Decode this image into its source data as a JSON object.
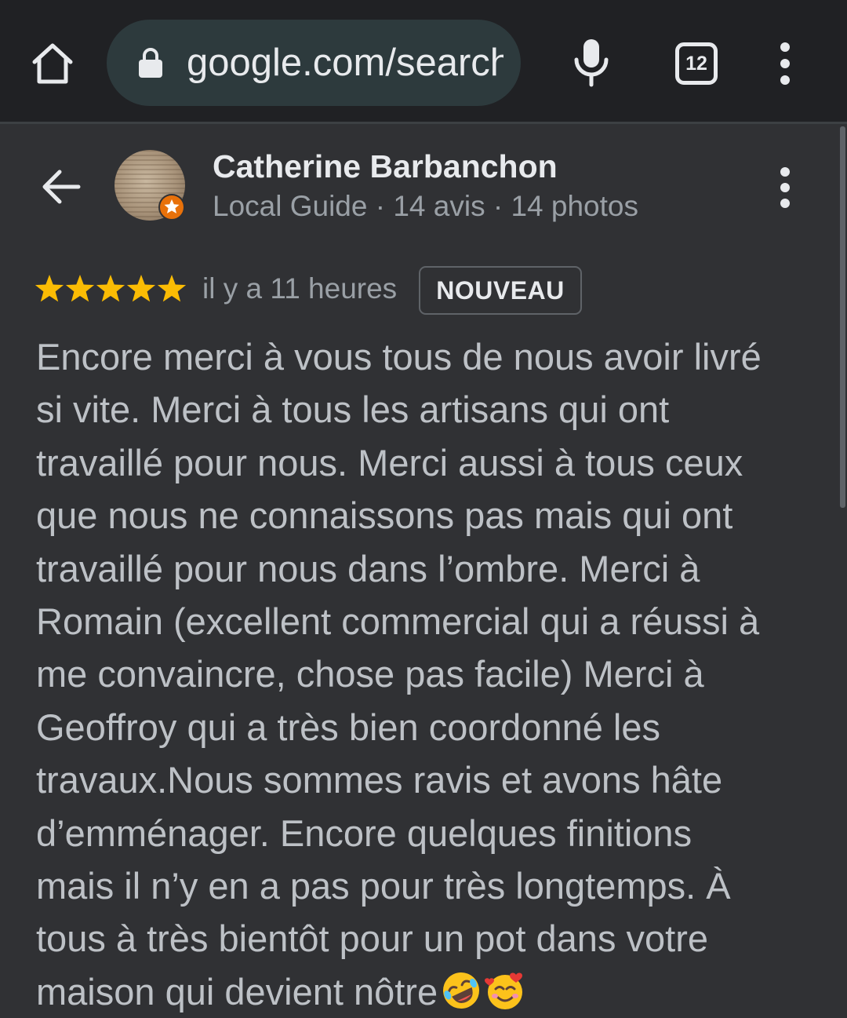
{
  "browser": {
    "url": "google.com/search",
    "tab_count": "12"
  },
  "reviewer": {
    "name": "Catherine Barbanchon",
    "meta": "Local Guide · 14 avis · 14 photos"
  },
  "review": {
    "rating": 5,
    "time": "il y a 11 heures",
    "badge": "NOUVEAU",
    "lines": [
      "Encore merci à vous tous de nous avoir livré",
      "si vite. Merci à tous les artisans qui ont",
      "travaillé pour nous. Merci aussi à tous ceux",
      "que nous ne connaissons pas mais qui ont",
      "travaillé pour nous dans l’ombre. Merci à",
      "Romain (excellent commercial qui a réussi à",
      "me convaincre, chose pas facile) Merci à",
      "Geoffroy qui a très bien coordonné les",
      "travaux.Nous sommes ravis et avons hâte",
      "d’emménager. Encore quelques finitions",
      "mais il n’y en a pas pour très longtemps. À",
      "tous à très bientôt pour un pot dans votre",
      "maison qui devient nôtre"
    ],
    "end_emojis": [
      "rolling-laughing-emoji",
      "smiling-hearts-emoji"
    ]
  },
  "colors": {
    "browser_bar": "#202124",
    "page_bg": "#303134",
    "star": "#fbbc04",
    "badge_orange": "#e8710a"
  },
  "icons": [
    "home-icon",
    "lock-icon",
    "mic-icon",
    "tabs-icon",
    "more-vert-icon",
    "back-arrow-icon",
    "local-guide-badge-icon",
    "star-icon"
  ]
}
